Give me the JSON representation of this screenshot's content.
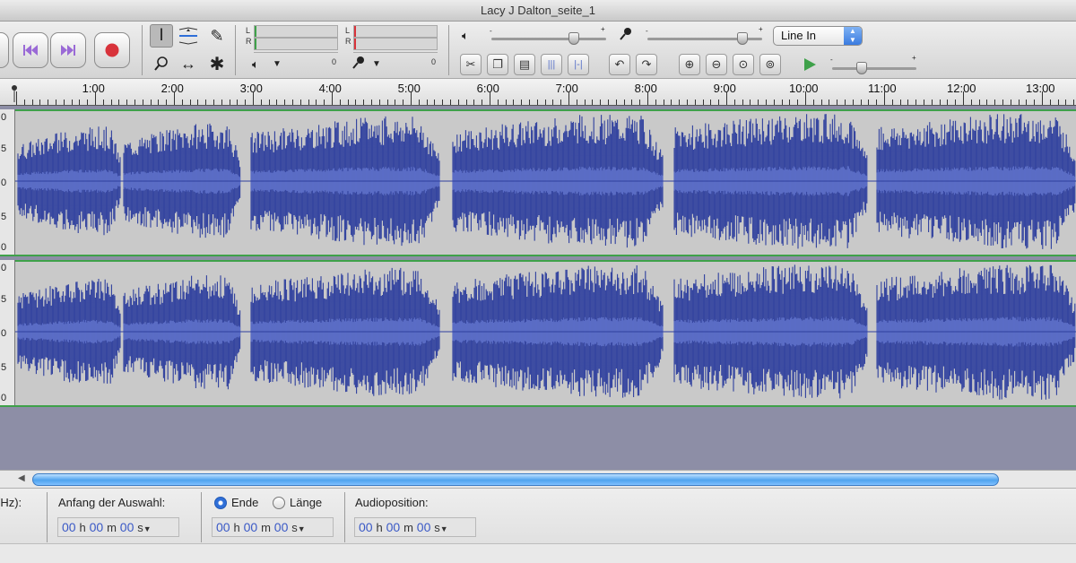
{
  "window": {
    "title": "Lacy J Dalton_seite_1"
  },
  "transport": {
    "buttons": [
      {
        "name": "skip-to-start-button",
        "icon": "skip-start-icon"
      },
      {
        "name": "skip-to-end-button",
        "icon": "skip-end-icon"
      },
      {
        "name": "record-button",
        "icon": "record-icon"
      }
    ],
    "colors": {
      "skip": "#9a6ad6",
      "record": "#d8333b"
    }
  },
  "tools": [
    "selection-tool",
    "envelope-tool",
    "draw-tool",
    "zoom-tool",
    "time-shift-tool",
    "multi-tool"
  ],
  "meters": {
    "output": {
      "l": "L",
      "r": "R",
      "zero": "0"
    },
    "input": {
      "l": "L",
      "r": "R",
      "zero": "0"
    }
  },
  "mixer": {
    "output_volume": 0.72,
    "input_volume": 0.83,
    "input_source": "Line In"
  },
  "play_at_speed": {
    "value": 0.35
  },
  "ruler": {
    "labels": [
      "1:00",
      "2:00",
      "3:00",
      "4:00",
      "5:00",
      "6:00",
      "7:00",
      "8:00",
      "9:00",
      "10:00",
      "11:00",
      "12:00",
      "13:00"
    ]
  },
  "tracks": {
    "scale_labels": [
      "0",
      "5",
      "0",
      "5",
      "0"
    ],
    "wave_color": "#2e3f9e",
    "rms_color": "#5c6ec8",
    "background": "#c9c9c9"
  },
  "status": {
    "rate_label": "(Hz):",
    "selection_start_label": "Anfang der Auswahl:",
    "end_label": "Ende",
    "length_label": "Länge",
    "audio_position_label": "Audioposition:",
    "time_start": {
      "h": "00",
      "m": "00",
      "s": "00",
      "hu": "h",
      "mu": "m",
      "su": "s"
    },
    "time_end": {
      "h": "00",
      "m": "00",
      "s": "00",
      "hu": "h",
      "mu": "m",
      "su": "s"
    },
    "time_pos": {
      "h": "00",
      "m": "00",
      "s": "00",
      "hu": "h",
      "mu": "m",
      "su": "s"
    }
  }
}
